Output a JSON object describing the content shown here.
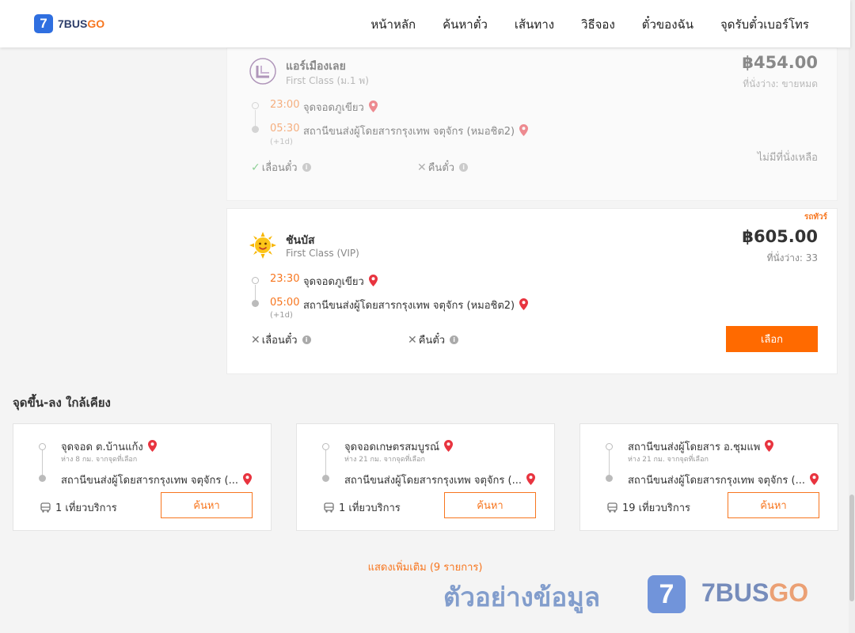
{
  "brand": {
    "logo_mark": "7",
    "name_part1": "7BUS",
    "name_part2": "GO"
  },
  "nav": [
    "หน้าหลัก",
    "ค้นหาตั๋ว",
    "เส้นทาง",
    "วิธีจอง",
    "ตั๋วของฉัน",
    "จุดรับตั๋วเบอร์โทร"
  ],
  "trips": [
    {
      "operator": "แอร์เมืองเลย",
      "bus_class": "First Class (ม.1 พ)",
      "price": "฿454.00",
      "seats": "ที่นั่งว่าง: ขายหมด",
      "depart_time": "23:00",
      "depart_stop": "จุดจอดภูเขียว",
      "arrive_time": "05:30",
      "arrive_stop": "สถานีขนส่งผู้โดยสารกรุงเทพ จตุจักร (หมอชิต2)",
      "next_day": "(+1d)",
      "change_label": "เลื่อนตั๋ว",
      "refund_label": "คืนตั๋ว",
      "status": "ไม่มีที่นั่งเหลือ"
    },
    {
      "operator": "ชันบัส",
      "bus_class": "First Class (VIP)",
      "price": "฿605.00",
      "seats": "ที่นั่งว่าง: 33",
      "depart_time": "23:30",
      "depart_stop": "จุดจอดภูเขียว",
      "arrive_time": "05:00",
      "arrive_stop": "สถานีขนส่งผู้โดยสารกรุงเทพ จตุจักร (หมอชิต2)",
      "next_day": "(+1d)",
      "change_label": "เลื่อนตั๋ว",
      "refund_label": "คืนตั๋ว",
      "tag": "รถทัวร์",
      "select_label": "เลือก"
    }
  ],
  "nearby": {
    "title": "จุดขึ้น-ลง ใกล้เคียง",
    "items": [
      {
        "from": "จุดจอด ต.บ้านแก้ง",
        "distance": "ห่าง 8 กม. จากจุดที่เลือก",
        "to": "สถานีขนส่งผู้โดยสารกรุงเทพ จตุจักร (...",
        "trips": "1 เที่ยวบริการ",
        "button": "ค้นหา"
      },
      {
        "from": "จุดจอดเกษตรสมบูรณ์",
        "distance": "ห่าง 21 กม. จากจุดที่เลือก",
        "to": "สถานีขนส่งผู้โดยสารกรุงเทพ จตุจักร (...",
        "trips": "1 เที่ยวบริการ",
        "button": "ค้นหา"
      },
      {
        "from": "สถานีขนส่งผู้โดยสาร อ.ชุมแพ",
        "distance": "ห่าง 21 กม. จากจุดที่เลือก",
        "to": "สถานีขนส่งผู้โดยสารกรุงเทพ จตุจักร (...",
        "trips": "19 เที่ยวบริการ",
        "button": "ค้นหา"
      }
    ],
    "show_more": "แสดงเพิ่มเติม (9 รายการ)"
  },
  "watermark": {
    "text": "ตัวอย่างข้อมูล",
    "mark": "7",
    "brand_part1": "7BUS",
    "brand_part2": "GO"
  },
  "colors": {
    "accent": "#ff6a00",
    "pin": "#e8343f",
    "logo_blue": "#2f6fe0"
  }
}
